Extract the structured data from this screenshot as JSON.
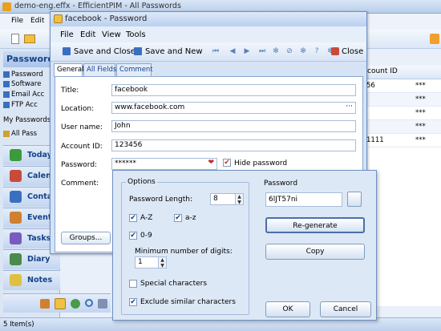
{
  "main": {
    "title": "demo-eng.effx - EfficientPIM - All Passwords",
    "menu": [
      "File",
      "Edit"
    ],
    "sidebar_header": "Passwords",
    "sidebar_items": [
      "Password",
      "Software",
      "Email Acc",
      "FTP Acc"
    ],
    "my_passwords": "My Passwords",
    "all_passwords": "All Pass",
    "nav": [
      "Today",
      "Calendar",
      "Contacts",
      "Events",
      "Tasks",
      "Diary",
      "Notes"
    ],
    "right_header": "count ID",
    "right_rows": [
      {
        "a": "56",
        "b": "***"
      },
      {
        "a": "",
        "b": "***"
      },
      {
        "a": "",
        "b": "***"
      },
      {
        "a": "",
        "b": "***"
      },
      {
        "a": "1111",
        "b": "***"
      }
    ],
    "status": "5 Item(s)"
  },
  "password_window": {
    "title": "facebook - Password",
    "menu": [
      "File",
      "Edit",
      "View",
      "Tools"
    ],
    "toolbar": {
      "save_close": "Save and Close",
      "save_new": "Save and New",
      "close": "Close"
    },
    "tabs": [
      "General",
      "All Fields",
      "Comment"
    ],
    "labels": {
      "title": "Title:",
      "location": "Location:",
      "user": "User name:",
      "account": "Account ID:",
      "password": "Password:",
      "comment": "Comment:"
    },
    "values": {
      "title": "facebook",
      "location": "www.facebook.com",
      "user": "John",
      "account": "123456",
      "password": "******"
    },
    "hide_password": "Hide password",
    "groups": "Groups..."
  },
  "generator": {
    "options_label": "Options",
    "length_label": "Password Length:",
    "length_value": "8",
    "az_upper": "A-Z",
    "az_lower": "a-z",
    "digits": "0-9",
    "min_digits_label": "Minimum number of digits:",
    "min_digits_value": "1",
    "special": "Special characters",
    "exclude": "Exclude similar characters",
    "password_label": "Password",
    "generated": "6lJT57ni",
    "regenerate": "Re-generate",
    "copy": "Copy",
    "ok": "OK",
    "cancel": "Cancel",
    "checked": {
      "az_upper": true,
      "az_lower": true,
      "digits": true,
      "special": false,
      "exclude": true
    }
  }
}
